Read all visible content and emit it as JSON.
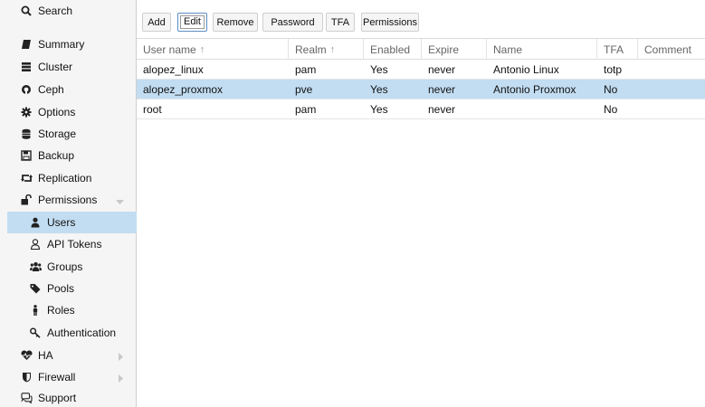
{
  "sidebar": {
    "items": [
      {
        "label": "Search",
        "icon": "search-icon"
      },
      {
        "label": "Summary",
        "icon": "book-icon"
      },
      {
        "label": "Cluster",
        "icon": "server-icon"
      },
      {
        "label": "Ceph",
        "icon": "ceph-icon"
      },
      {
        "label": "Options",
        "icon": "gear-icon"
      },
      {
        "label": "Storage",
        "icon": "database-icon"
      },
      {
        "label": "Backup",
        "icon": "floppy-icon"
      },
      {
        "label": "Replication",
        "icon": "retweet-icon"
      },
      {
        "label": "Permissions",
        "icon": "unlock-icon"
      },
      {
        "label": "Users",
        "icon": "user-icon"
      },
      {
        "label": "API Tokens",
        "icon": "user-outline-icon"
      },
      {
        "label": "Groups",
        "icon": "users-icon"
      },
      {
        "label": "Pools",
        "icon": "tags-icon"
      },
      {
        "label": "Roles",
        "icon": "male-icon"
      },
      {
        "label": "Authentication",
        "icon": "key-icon"
      },
      {
        "label": "HA",
        "icon": "heartbeat-icon"
      },
      {
        "label": "Firewall",
        "icon": "shield-icon"
      },
      {
        "label": "Support",
        "icon": "comments-icon"
      }
    ],
    "selected": "Users"
  },
  "toolbar": {
    "add": "Add",
    "edit": "Edit",
    "remove": "Remove",
    "password": "Password",
    "tfa": "TFA",
    "permissions": "Permissions"
  },
  "grid": {
    "columns": [
      "User name",
      "Realm",
      "Enabled",
      "Expire",
      "Name",
      "TFA",
      "Comment"
    ],
    "sort_indicator": "↑",
    "rows": [
      {
        "username": "alopez_linux",
        "realm": "pam",
        "enabled": "Yes",
        "expire": "never",
        "name": "Antonio Linux",
        "tfa": "totp",
        "comment": ""
      },
      {
        "username": "alopez_proxmox",
        "realm": "pve",
        "enabled": "Yes",
        "expire": "never",
        "name": "Antonio Proxmox",
        "tfa": "No",
        "comment": ""
      },
      {
        "username": "root",
        "realm": "pam",
        "enabled": "Yes",
        "expire": "never",
        "name": "",
        "tfa": "No",
        "comment": ""
      }
    ],
    "selected_row": "alopez_proxmox"
  },
  "colors": {
    "selection": "#c2ddf2",
    "sidebar_bg": "#f5f5f5",
    "header_text": "#666666"
  }
}
